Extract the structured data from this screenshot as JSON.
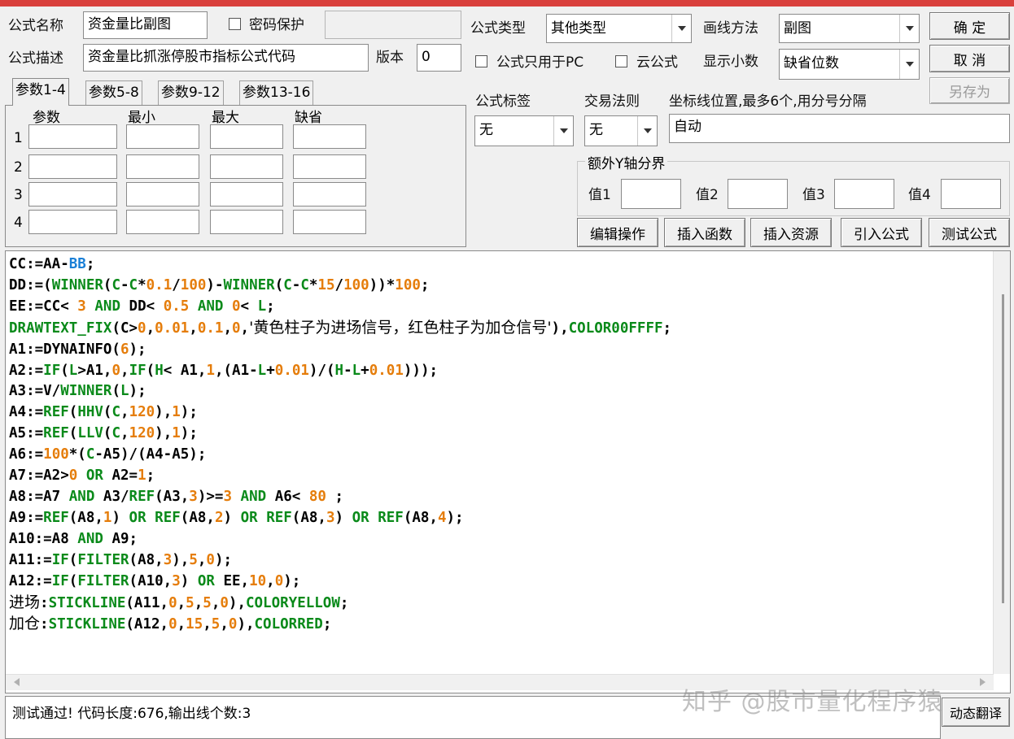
{
  "form": {
    "name_label": "公式名称",
    "name_value": "资金量比副图",
    "password_label": "密码保护",
    "desc_label": "公式描述",
    "desc_value": "资金量比抓涨停股市指标公式代码",
    "version_label": "版本",
    "version_value": "0",
    "type_label": "公式类型",
    "type_value": "其他类型",
    "draw_label": "画线方法",
    "draw_value": "副图",
    "pc_only_label": "公式只用于PC",
    "cloud_label": "云公式",
    "decimals_label": "显示小数",
    "decimals_value": "缺省位数",
    "tag_label": "公式标签",
    "tag_value": "无",
    "rule_label": "交易法则",
    "rule_value": "无",
    "axis_label": "坐标线位置,最多6个,用分号分隔",
    "axis_value": "自动",
    "extra_y_label": "额外Y轴分界",
    "val1": "值1",
    "val2": "值2",
    "val3": "值3",
    "val4": "值4"
  },
  "buttons": {
    "ok": "确 定",
    "cancel": "取 消",
    "save_as": "另存为",
    "edit_ops": "编辑操作",
    "insert_func": "插入函数",
    "insert_res": "插入资源",
    "import": "引入公式",
    "test": "测试公式",
    "translate": "动态翻译"
  },
  "tabs": [
    "参数1-4",
    "参数5-8",
    "参数9-12",
    "参数13-16"
  ],
  "param_headers": [
    "参数",
    "最小",
    "最大",
    "缺省"
  ],
  "param_rows": [
    "1",
    "2",
    "3",
    "4"
  ],
  "status_text": "测试通过! 代码长度:676,输出线个数:3",
  "watermark": "知乎 @股市量化程序猿",
  "code_lines": [
    "CC:=AA-BB;",
    "DD:=(WINNER(C-C*0.1/100)-WINNER(C-C*15/100))*100;",
    "EE:=CC< 3 AND DD< 0.5 AND 0< L;",
    "DRAWTEXT_FIX(C>0,0.01,0.1,0,'黄色柱子为进场信号，红色柱子为加仓信号'),COLOR00FFFF;",
    "A1:=DYNAINFO(6);",
    "A2:=IF(L>A1,0,IF(H< A1,1,(A1-L+0.01)/(H-L+0.01)));",
    "A3:=V/WINNER(L);",
    "A4:=REF(HHV(C,120),1);",
    "A5:=REF(LLV(C,120),1);",
    "A6:=100*(C-A5)/(A4-A5);",
    "A7:=A2>0 OR A2=1;",
    "A8:=A7 AND A3/REF(A3,3)>=3 AND A6< 80 ;",
    "A9:=REF(A8,1) OR REF(A8,2) OR REF(A8,3) OR REF(A8,4);",
    "A10:=A8 AND A9;",
    "A11:=IF(FILTER(A8,3),5,0);",
    "A12:=IF(FILTER(A10,3) OR EE,10,0);",
    "进场:STICKLINE(A11,0,5,5,0),COLORYELLOW;",
    "加仓:STICKLINE(A12,0,15,5,0),COLORRED;"
  ],
  "colors": {
    "keyword": "#0a8a1a",
    "number": "#e57d0b",
    "variable": "#1a7fd6",
    "titlebar": "#d9403c"
  }
}
